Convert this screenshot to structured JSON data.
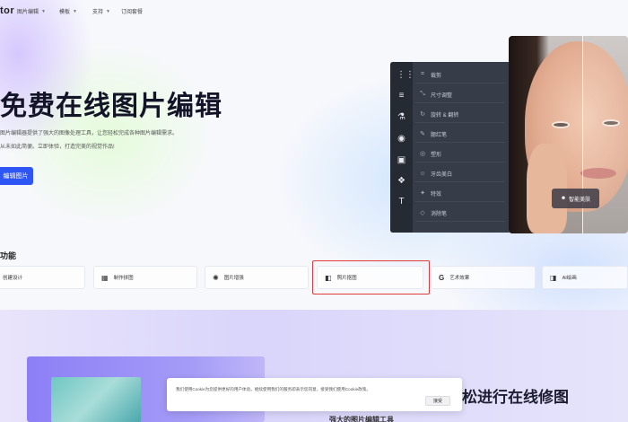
{
  "nav": {
    "logo": "tor",
    "items": [
      {
        "label": "图片编辑",
        "has_caret": true
      },
      {
        "label": "模板",
        "has_caret": true
      },
      {
        "label": "支持",
        "has_caret": true
      },
      {
        "label": "订阅套餐",
        "has_caret": false
      }
    ]
  },
  "hero": {
    "title": "免费在线图片编辑",
    "desc_line1": "图片编辑器提供了强大的图像处理工具，让您轻松完成各种图片编辑需求。",
    "desc_line2": "从未如此简便。立即体验，打造完美的视觉作品!",
    "cta_label": "编辑图片"
  },
  "editor": {
    "menu": [
      {
        "icon": "crop-icon",
        "glyph": "⌗",
        "label": "裁剪"
      },
      {
        "icon": "resize-icon",
        "glyph": "⤡",
        "label": "尺寸调整"
      },
      {
        "icon": "rotate-icon",
        "glyph": "↻",
        "label": "旋转 & 翻转"
      },
      {
        "icon": "brush-icon",
        "glyph": "✎",
        "label": "腮红笔"
      },
      {
        "icon": "reshape-icon",
        "glyph": "◎",
        "label": "塑形"
      },
      {
        "icon": "teeth-icon",
        "glyph": "☺",
        "label": "牙齿美白"
      },
      {
        "icon": "effects-icon",
        "glyph": "✦",
        "label": "特效"
      },
      {
        "icon": "eraser-icon",
        "glyph": "◇",
        "label": "消除笔"
      }
    ],
    "badge": "智能美肤"
  },
  "features": {
    "title": "功能",
    "items": [
      {
        "icon": "design-icon",
        "glyph": "",
        "label": "创建设计"
      },
      {
        "icon": "collage-icon",
        "glyph": "▦",
        "label": "制作拼图"
      },
      {
        "icon": "enhance-icon",
        "glyph": "✺",
        "label": "图片增强"
      },
      {
        "icon": "cutout-icon",
        "glyph": "◧",
        "label": "照片抠图"
      },
      {
        "icon": "art-effect-icon",
        "glyph": "G",
        "label": "艺术效果"
      },
      {
        "icon": "ai-icon",
        "glyph": "◨",
        "label": "AI绘画"
      }
    ]
  },
  "lower": {
    "title": "松进行在线修图",
    "subtitle": "强大的图片编辑工具"
  },
  "cookie": {
    "text": "我们使用Cookie为您提供更好的用户体验。继续使用我们的服务即表示您同意，接受我们使用Cookie政策。",
    "button": "接受"
  }
}
